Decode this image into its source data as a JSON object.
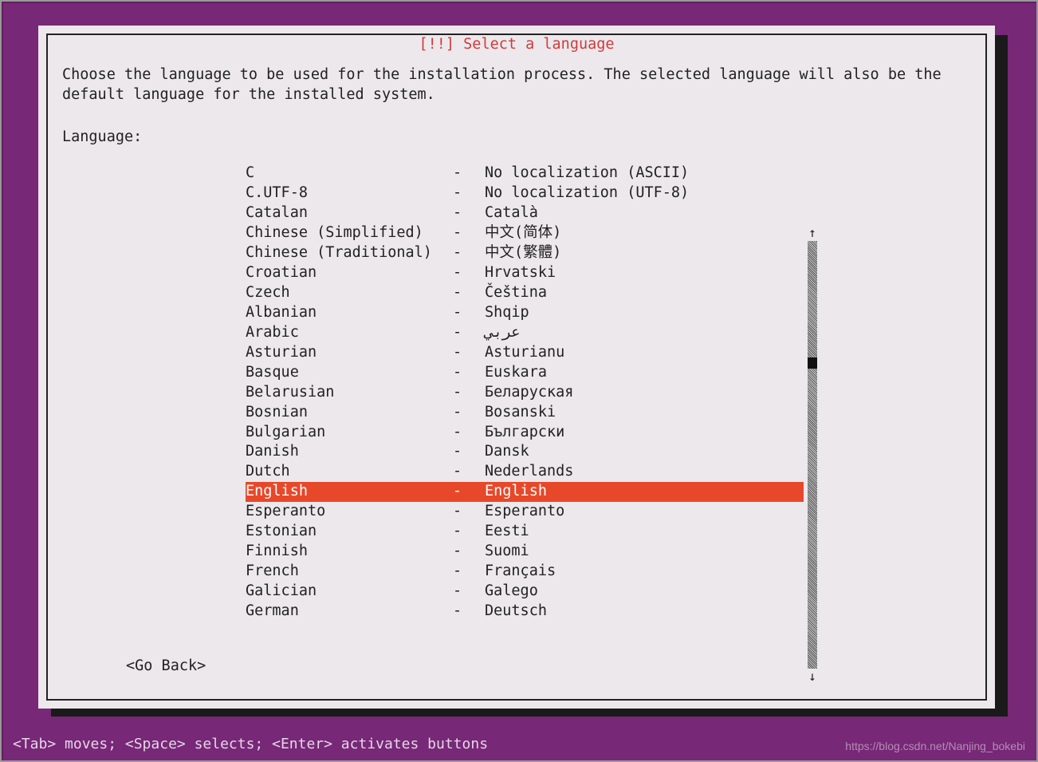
{
  "title": "[!!] Select a language",
  "description": "Choose the language to be used for the installation process. The selected language will also be the default language for the installed system.",
  "prompt": "Language:",
  "selected_index": 16,
  "languages": [
    {
      "name": "C",
      "sep": "-",
      "loc": "No localization (ASCII)"
    },
    {
      "name": "C.UTF-8",
      "sep": "-",
      "loc": "No localization (UTF-8)"
    },
    {
      "name": "Catalan",
      "sep": "-",
      "loc": "Català"
    },
    {
      "name": "Chinese (Simplified)",
      "sep": "-",
      "loc": "中文(简体)"
    },
    {
      "name": "Chinese (Traditional)",
      "sep": "-",
      "loc": "中文(繁體)"
    },
    {
      "name": "Croatian",
      "sep": "-",
      "loc": "Hrvatski"
    },
    {
      "name": "Czech",
      "sep": "-",
      "loc": "Čeština"
    },
    {
      "name": "Albanian",
      "sep": "-",
      "loc": "Shqip"
    },
    {
      "name": "Arabic",
      "sep": "-",
      "loc": "عربي"
    },
    {
      "name": "Asturian",
      "sep": "-",
      "loc": "Asturianu"
    },
    {
      "name": "Basque",
      "sep": "-",
      "loc": "Euskara"
    },
    {
      "name": "Belarusian",
      "sep": "-",
      "loc": "Беларуская"
    },
    {
      "name": "Bosnian",
      "sep": "-",
      "loc": "Bosanski"
    },
    {
      "name": "Bulgarian",
      "sep": "-",
      "loc": "Български"
    },
    {
      "name": "Danish",
      "sep": "-",
      "loc": "Dansk"
    },
    {
      "name": "Dutch",
      "sep": "-",
      "loc": "Nederlands"
    },
    {
      "name": "English",
      "sep": "-",
      "loc": "English"
    },
    {
      "name": "Esperanto",
      "sep": "-",
      "loc": "Esperanto"
    },
    {
      "name": "Estonian",
      "sep": "-",
      "loc": "Eesti"
    },
    {
      "name": "Finnish",
      "sep": "-",
      "loc": "Suomi"
    },
    {
      "name": "French",
      "sep": "-",
      "loc": "Français"
    },
    {
      "name": "Galician",
      "sep": "-",
      "loc": "Galego"
    },
    {
      "name": "German",
      "sep": "-",
      "loc": "Deutsch"
    }
  ],
  "go_back": "<Go Back>",
  "hints": "<Tab> moves; <Space> selects; <Enter> activates buttons",
  "scroll": {
    "up": "↑",
    "down": "↓"
  },
  "watermark": "https://blog.csdn.net/Nanjing_bokebi"
}
